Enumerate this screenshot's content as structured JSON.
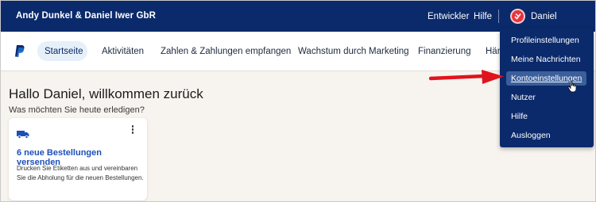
{
  "topbar": {
    "company": "Andy Dunkel & Daniel Iwer GbR",
    "developer_link": "Entwickler",
    "help_link": "Hilfe",
    "user_name": "Daniel"
  },
  "nav": {
    "items": [
      "Startseite",
      "Aktivitäten",
      "Zahlen & Zahlungen empfangen",
      "Wachstum durch Marketing",
      "Finanzierung",
      "Hän"
    ],
    "active": "Startseite"
  },
  "main": {
    "greeting": "Hallo Daniel, willkommen zurück",
    "subtitle": "Was möchten Sie heute erledigen?"
  },
  "card": {
    "title": "6 neue Bestellungen versenden",
    "description": "Drucken Sie Etiketten aus und vereinbaren Sie die Abholung für die neuen Bestellungen."
  },
  "dropdown": {
    "items": [
      "Profileinstellungen",
      "Meine Nachrichten",
      "Kontoeinstellungen",
      "Nutzer",
      "Hilfe",
      "Ausloggen"
    ],
    "hovered": "Kontoeinstellungen"
  },
  "colors": {
    "brand_navy": "#0b2a6b",
    "link_blue": "#1d4fb8",
    "annotation_arrow": "#e0141e",
    "avatar_red": "#e8333c"
  },
  "icons": [
    "paypal-logo",
    "truck-icon",
    "kebab-menu-icon",
    "avatar-icon",
    "pointer-cursor-icon",
    "annotation-arrow"
  ]
}
